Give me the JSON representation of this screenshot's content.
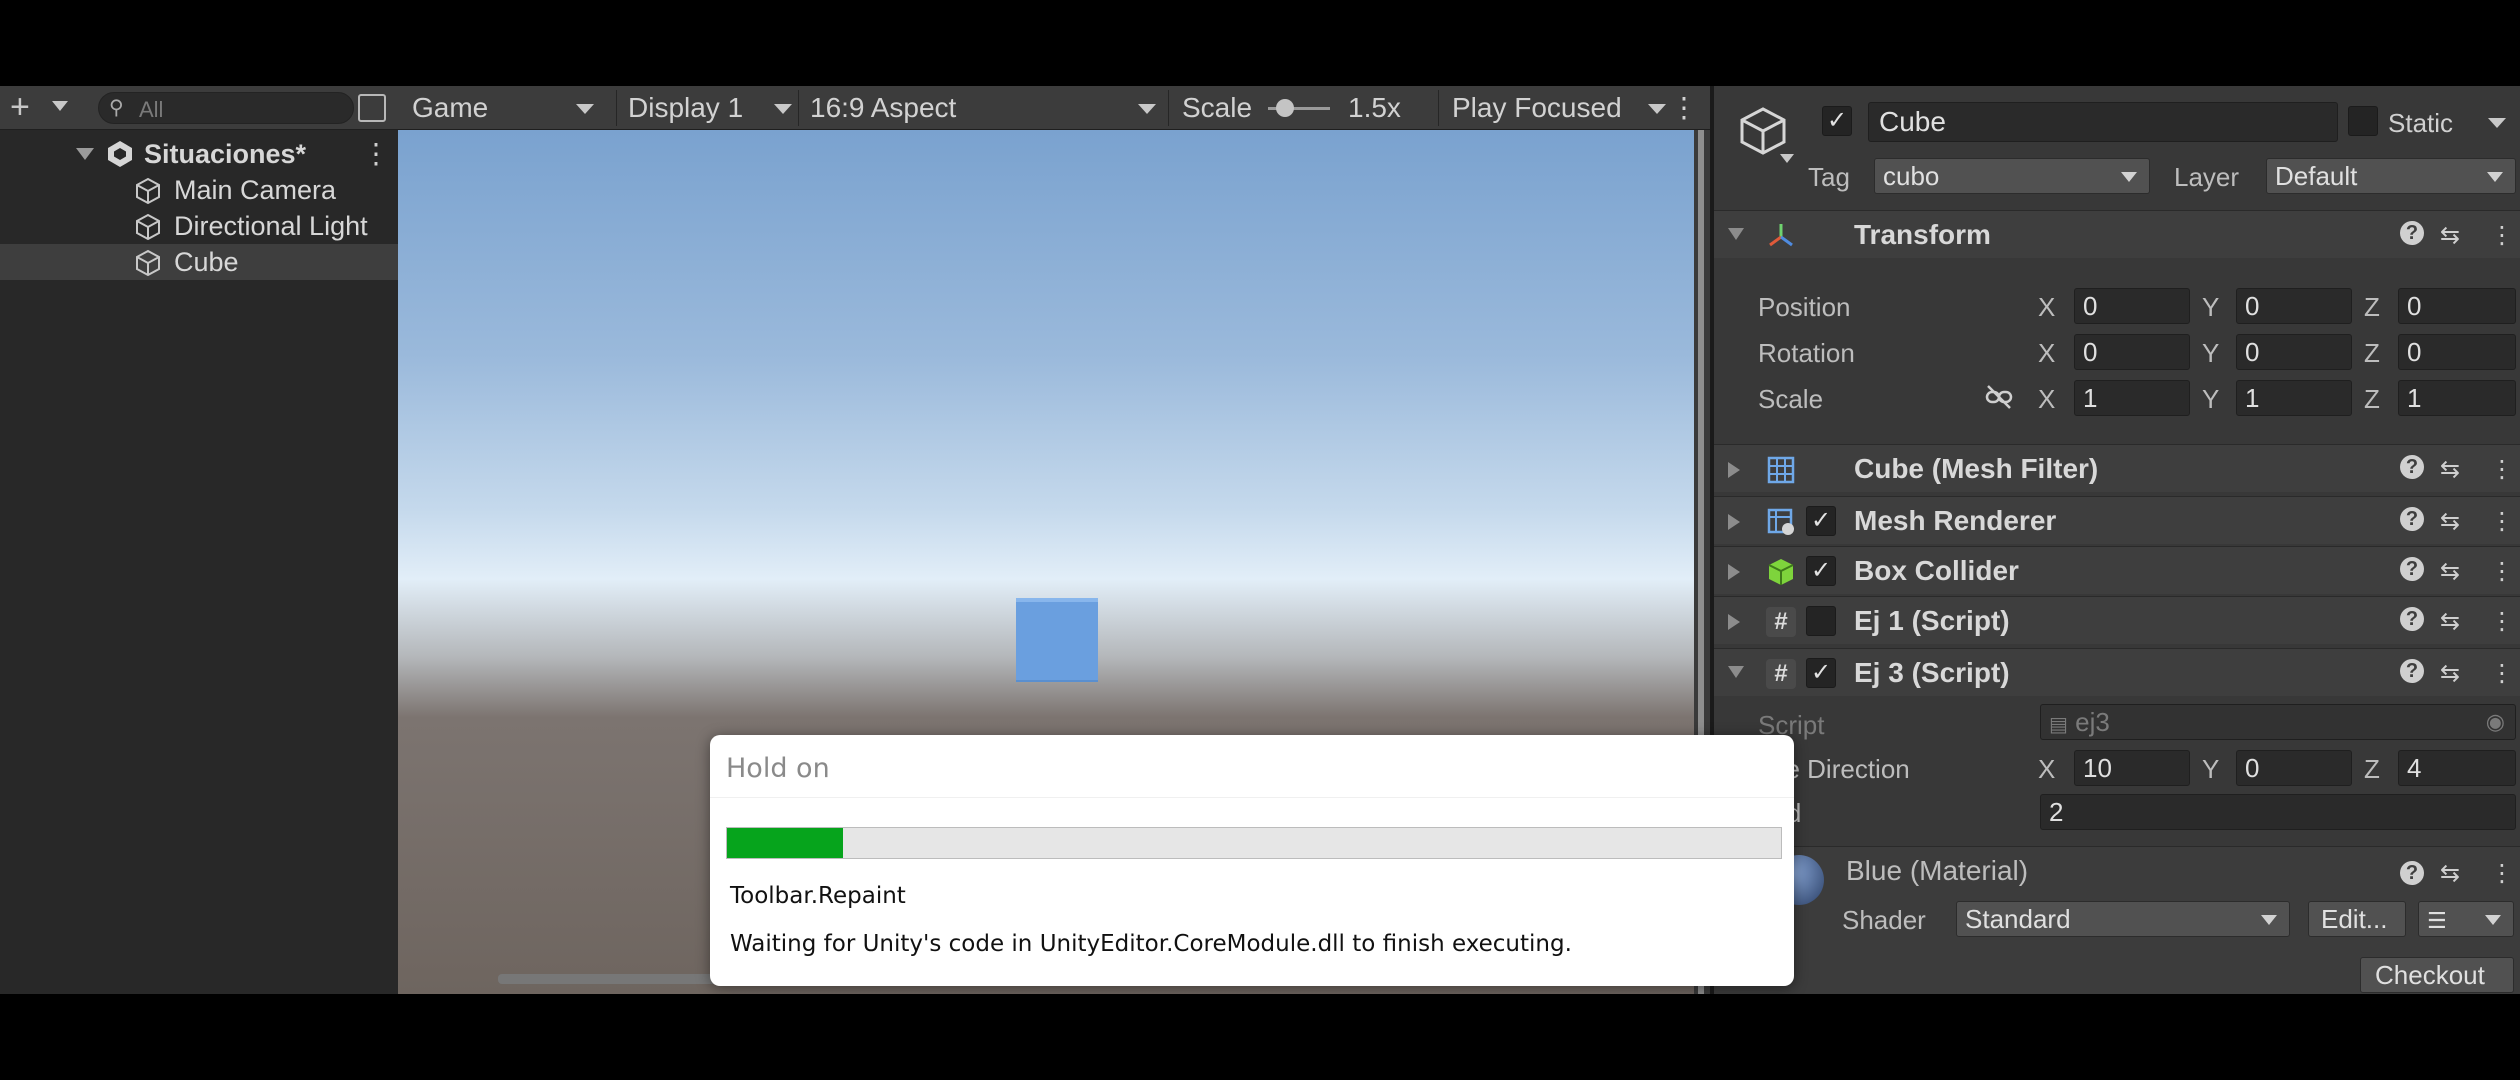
{
  "hierarchy": {
    "search_placeholder": "All",
    "scene_name": "Situaciones*",
    "objects": [
      "Main Camera",
      "Directional Light",
      "Cube"
    ],
    "selected": "Cube"
  },
  "game_toolbar": {
    "tab": "Game",
    "display": "Display 1",
    "aspect": "16:9 Aspect",
    "scale_label": "Scale",
    "scale_value": "1.5x",
    "play_mode": "Play Focused"
  },
  "inspector": {
    "object_name": "Cube",
    "active": true,
    "static_label": "Static",
    "tag_label": "Tag",
    "tag_value": "cubo",
    "layer_label": "Layer",
    "layer_value": "Default",
    "transform": {
      "title": "Transform",
      "position_label": "Position",
      "rotation_label": "Rotation",
      "scale_label": "Scale",
      "position": {
        "x": "0",
        "y": "0",
        "z": "0"
      },
      "rotation": {
        "x": "0",
        "y": "0",
        "z": "0"
      },
      "scale": {
        "x": "1",
        "y": "1",
        "z": "1"
      }
    },
    "components": [
      {
        "title": "Cube (Mesh Filter)",
        "icon": "mesh-filter-icon"
      },
      {
        "title": "Mesh Renderer",
        "icon": "mesh-renderer-icon",
        "enabled": true
      },
      {
        "title": "Box Collider",
        "icon": "box-collider-icon",
        "enabled": true
      },
      {
        "title": "Ej 1 (Script)",
        "icon": "script-icon",
        "enabled": false
      },
      {
        "title": "Ej 3 (Script)",
        "icon": "script-icon",
        "enabled": true
      }
    ],
    "ej3": {
      "script_label": "Script",
      "script_value": "ej3",
      "move_direction_label": "ove Direction",
      "move_direction": {
        "x": "10",
        "y": "0",
        "z": "4"
      },
      "speed_label": "eed",
      "speed_value": "2"
    },
    "material": {
      "title": "Blue (Material)",
      "shader_label": "Shader",
      "shader_value": "Standard",
      "edit_label": "Edit...",
      "checkout_label": "Checkout"
    },
    "axes": {
      "x": "X",
      "y": "Y",
      "z": "Z"
    }
  },
  "dialog": {
    "title": "Hold on",
    "progress_fraction": 0.11,
    "line1": "Toolbar.Repaint",
    "line2": "Waiting for Unity's code in UnityEditor.CoreModule.dll to finish executing."
  },
  "colors": {
    "progress": "#06a41c",
    "cube": "#6a9fdf"
  }
}
